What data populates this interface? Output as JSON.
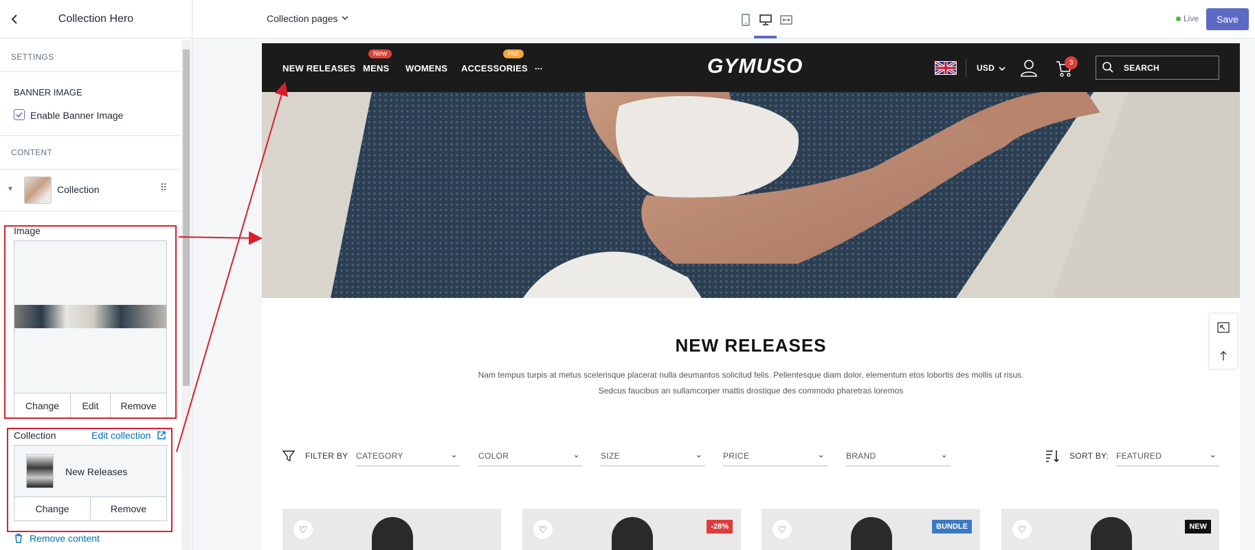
{
  "sidebar": {
    "title": "Collection Hero",
    "settings_label": "SETTINGS",
    "banner_heading": "BANNER IMAGE",
    "enable_banner_label": "Enable Banner Image",
    "content_label": "CONTENT",
    "block_label": "Collection",
    "image_label": "Image",
    "image_buttons": [
      "Change",
      "Edit",
      "Remove"
    ],
    "collection_label": "Collection",
    "edit_collection_link": "Edit collection",
    "collection_name": "New Releases",
    "collection_buttons": [
      "Change",
      "Remove"
    ],
    "remove_content": "Remove content"
  },
  "topbar": {
    "page_select": "Collection pages",
    "status": "Live",
    "save_label": "Save",
    "status_color": "#50b83c",
    "accent": "#5c6ac4"
  },
  "store": {
    "nav": [
      "NEW RELEASES",
      "MENS",
      "WOMENS",
      "ACCESSORIES",
      "..."
    ],
    "tags": {
      "mens": "New",
      "accessories": "Hot"
    },
    "logo": "GYMUSO",
    "currency": "USD",
    "cart_count": "3",
    "search_placeholder": "SEARCH",
    "heading": "NEW RELEASES",
    "description_1": "Nam tempus turpis at metus scelerisque placerat nulla deumantos solicitud felis. Pellentesque diam dolor, elementum etos lobortis des mollis ut risus.",
    "description_2": "Sedcus faucibus an sullamcorper mattis drostique des commodo pharetras loremos",
    "filter_by": "FILTER BY",
    "filters": [
      "CATEGORY",
      "COLOR",
      "SIZE",
      "PRICE",
      "BRAND"
    ],
    "sort_by": "SORT BY:",
    "sort_value": "FEATURED",
    "badges": [
      "-28%",
      "BUNDLE",
      "NEW"
    ],
    "badge_colors": [
      "#e03c3c",
      "#3d79c4",
      "#111111"
    ]
  }
}
